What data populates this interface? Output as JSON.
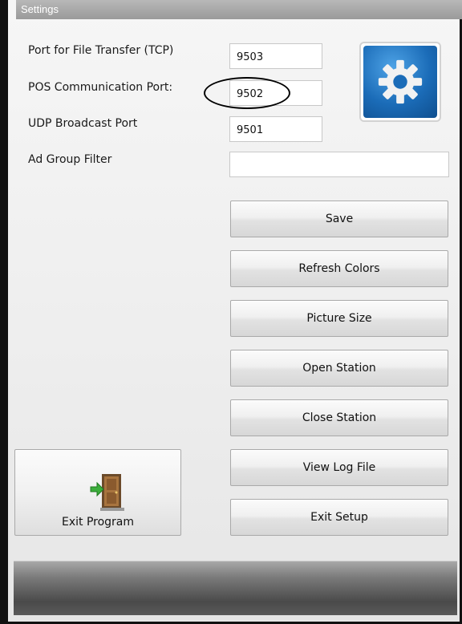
{
  "window": {
    "title": "Settings"
  },
  "fields": {
    "file_transfer_port": {
      "label": "Port for File Transfer (TCP)",
      "value": "9503"
    },
    "pos_comm_port": {
      "label": "POS Communication Port:",
      "value": "9502"
    },
    "udp_broadcast_port": {
      "label": "UDP Broadcast Port",
      "value": "9501"
    },
    "ad_group_filter": {
      "label": "Ad Group Filter",
      "value": ""
    }
  },
  "buttons": {
    "save": "Save",
    "refresh_colors": "Refresh Colors",
    "picture_size": "Picture Size",
    "open_station": "Open Station",
    "close_station": "Close Station",
    "view_log_file": "View Log File",
    "exit_setup": "Exit Setup",
    "exit_program": "Exit Program"
  },
  "icons": {
    "settings": "gear-icon",
    "exit": "door-exit-icon"
  },
  "colors": {
    "title_bar": "#9e9e9e",
    "gear_tile": "#1b6cb8",
    "status_bar": "#4a4a4a"
  }
}
